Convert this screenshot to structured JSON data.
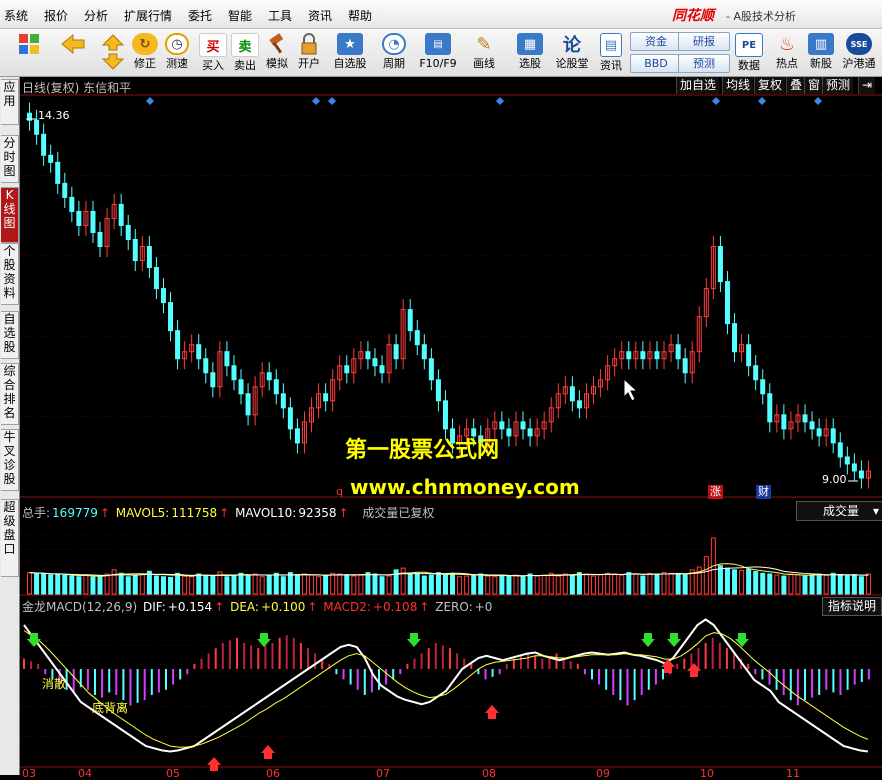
{
  "menu": [
    "系统",
    "报价",
    "分析",
    "扩展行情",
    "委托",
    "智能",
    "工具",
    "资讯",
    "帮助"
  ],
  "brand": {
    "logo": "同花顺",
    "subtitle": "- A股技术分析"
  },
  "toolbar": {
    "buttons": [
      {
        "label": "",
        "icon": "windows-icon"
      },
      {
        "label": "",
        "icon": "back-arrow-icon"
      },
      {
        "label": "",
        "icon": "up-down-icon"
      },
      {
        "label": "修正",
        "icon": "fix-icon"
      },
      {
        "label": "测速",
        "icon": "clock-icon"
      },
      {
        "label": "买入",
        "icon": "buy-icon",
        "glyph": "买"
      },
      {
        "label": "卖出",
        "icon": "sell-icon",
        "glyph": "卖"
      },
      {
        "label": "模拟",
        "icon": "gavel-icon"
      },
      {
        "label": "开户",
        "icon": "lock-icon"
      },
      {
        "label": "自选股",
        "icon": "star-icon"
      },
      {
        "label": "周期",
        "icon": "period-icon"
      },
      {
        "label": "F10/F9",
        "icon": "f10-icon"
      },
      {
        "label": "画线",
        "icon": "pencil-icon"
      },
      {
        "label": "选股",
        "icon": "select-icon"
      },
      {
        "label": "论股堂",
        "icon": "forum-icon",
        "glyph": "论"
      },
      {
        "label": "资讯",
        "icon": "news-icon"
      },
      {
        "label": "数据",
        "icon": "pe-icon",
        "glyph": "PE"
      },
      {
        "label": "热点",
        "icon": "fire-icon"
      },
      {
        "label": "新股",
        "icon": "newstock-icon"
      },
      {
        "label": "沪港通",
        "icon": "hk-icon"
      }
    ],
    "pills": [
      "资金",
      "研报",
      "BBD",
      "预测"
    ]
  },
  "sidebar": [
    "应用",
    "分时图",
    "K线图",
    "个股资料",
    "自选股",
    "综合排名",
    "牛叉诊股",
    "超级盘口"
  ],
  "main_header": {
    "title": "日线(复权) 东信和平"
  },
  "right_tabs": [
    "加自选",
    "均线",
    "复权",
    "叠",
    "窗",
    "预测"
  ],
  "price_high": "14.36",
  "price_low": "9.00",
  "volume_header": {
    "label": "总手:",
    "value": "169779",
    "ma5_label": "MAVOL5:",
    "ma5": "111758",
    "ma10_label": "MAVOL10:",
    "ma10": "92358",
    "note": "成交量已复权",
    "dropdown": "成交量"
  },
  "macd_header": {
    "label": "金龙MACD(12,26,9)",
    "dif_label": "DIF:",
    "dif": "+0.154",
    "dea_label": "DEA:",
    "dea": "+0.100",
    "macd2_label": "MACD2:",
    "macd2": "+0.108",
    "zero_label": "ZERO:",
    "zero": "+0",
    "help": "指标说明"
  },
  "macd_labels": {
    "a": "消散",
    "b": "底背离"
  },
  "badges": [
    {
      "text": "涨"
    },
    {
      "text": "财"
    },
    {
      "text": "q"
    }
  ],
  "watermark": {
    "cn": "第一股票公式网",
    "url": "www.chnmoney.com"
  },
  "months": [
    "03",
    "04",
    "05",
    "06",
    "07",
    "08",
    "09",
    "10",
    "11"
  ],
  "colors": {
    "up": "#ff3c3c",
    "down": "#54ffff",
    "dif": "#ffffff",
    "dea": "#ffff40",
    "accent": "#b01818"
  },
  "chart_data": {
    "type": "candlestick",
    "price_range": [
      9.0,
      14.36
    ],
    "closes": [
      14.2,
      14.0,
      13.7,
      13.6,
      13.3,
      13.1,
      12.9,
      12.7,
      12.9,
      12.6,
      12.4,
      12.8,
      13.0,
      12.7,
      12.5,
      12.2,
      12.4,
      12.1,
      11.8,
      11.6,
      11.2,
      10.8,
      10.9,
      11.0,
      10.8,
      10.6,
      10.4,
      10.9,
      10.7,
      10.5,
      10.3,
      10.0,
      10.4,
      10.6,
      10.5,
      10.3,
      10.1,
      9.8,
      9.6,
      9.9,
      10.1,
      10.3,
      10.2,
      10.5,
      10.7,
      10.6,
      10.8,
      10.9,
      10.8,
      10.7,
      10.6,
      11.0,
      10.8,
      11.5,
      11.2,
      11.0,
      10.8,
      10.5,
      10.2,
      9.8,
      9.6,
      9.7,
      9.8,
      9.7,
      9.6,
      9.8,
      9.9,
      9.8,
      9.7,
      9.9,
      9.8,
      9.7,
      9.8,
      9.9,
      10.1,
      10.3,
      10.4,
      10.2,
      10.1,
      10.3,
      10.4,
      10.5,
      10.7,
      10.8,
      10.9,
      10.8,
      10.9,
      10.8,
      10.9,
      10.8,
      10.9,
      11.0,
      10.8,
      10.6,
      10.9,
      11.4,
      11.8,
      12.4,
      11.9,
      11.3,
      10.9,
      11.0,
      10.7,
      10.5,
      10.3,
      9.9,
      10.0,
      9.8,
      9.9,
      10.0,
      9.9,
      9.8,
      9.7,
      9.8,
      9.6,
      9.4,
      9.3,
      9.2,
      9.1,
      9.2
    ]
  },
  "volume_data": [
    62,
    60,
    58,
    55,
    57,
    54,
    52,
    50,
    55,
    49,
    52,
    58,
    70,
    60,
    50,
    55,
    58,
    66,
    52,
    50,
    48,
    60,
    52,
    50,
    58,
    54,
    52,
    64,
    50,
    55,
    60,
    52,
    58,
    50,
    55,
    60,
    50,
    62,
    54,
    58,
    55,
    50,
    52,
    60,
    58,
    56,
    52,
    55,
    62,
    58,
    50,
    52,
    70,
    75,
    58,
    60,
    52,
    55,
    62,
    58,
    60,
    50,
    52,
    55,
    58,
    52,
    50,
    54,
    52,
    55,
    50,
    58,
    52,
    55,
    60,
    52,
    58,
    55,
    62,
    58,
    52,
    56,
    60,
    58,
    55,
    62,
    58,
    52,
    60,
    58,
    62,
    60,
    58,
    55,
    70,
    78,
    95,
    110,
    82,
    75,
    70,
    68,
    72,
    65,
    60,
    58,
    55,
    52,
    58,
    56,
    52,
    55,
    58,
    54,
    60,
    55,
    52,
    56,
    50,
    58
  ],
  "macd_hist": [
    4,
    3,
    2,
    -2,
    -4,
    -6,
    -8,
    -9,
    -7,
    -8,
    -10,
    -11,
    -9,
    -10,
    -12,
    -14,
    -13,
    -12,
    -10,
    -9,
    -8,
    -6,
    -4,
    -2,
    2,
    4,
    6,
    8,
    10,
    11,
    12,
    10,
    9,
    8,
    9,
    10,
    12,
    13,
    12,
    10,
    8,
    6,
    4,
    2,
    -2,
    -4,
    -6,
    -8,
    -10,
    -9,
    -8,
    -6,
    -4,
    -2,
    2,
    4,
    6,
    8,
    10,
    9,
    8,
    6,
    4,
    2,
    -2,
    -4,
    -3,
    -2,
    2,
    4,
    5,
    6,
    5,
    4,
    5,
    6,
    4,
    3,
    2,
    -2,
    -4,
    -6,
    -8,
    -10,
    -12,
    -14,
    -12,
    -10,
    -8,
    -6,
    -4,
    -2,
    2,
    4,
    6,
    8,
    10,
    12,
    10,
    8,
    6,
    4,
    2,
    -2,
    -4,
    -6,
    -8,
    -10,
    -12,
    -14,
    -12,
    -11,
    -10,
    -8,
    -9,
    -10,
    -8,
    -6,
    -5,
    -4
  ],
  "macd_dif": [
    0.4,
    0.3,
    0.2,
    0.1,
    0.0,
    -0.1,
    -0.2,
    -0.3,
    -0.35,
    -0.4,
    -0.45,
    -0.5,
    -0.55,
    -0.6,
    -0.65,
    -0.7,
    -0.72,
    -0.74,
    -0.75,
    -0.74,
    -0.72,
    -0.7,
    -0.65,
    -0.6,
    -0.55,
    -0.5,
    -0.45,
    -0.4,
    -0.35,
    -0.3,
    -0.25,
    -0.2,
    -0.15,
    -0.1,
    -0.05,
    0.0,
    0.05,
    0.1,
    0.15,
    0.2,
    0.22,
    0.2,
    0.1,
    -0.05,
    -0.15,
    -0.2,
    -0.25,
    -0.28,
    -0.3,
    -0.32,
    -0.3,
    -0.25,
    -0.2,
    -0.1,
    0.0,
    0.05,
    0.1,
    0.12,
    0.1,
    0.08,
    0.1,
    0.12,
    0.14,
    0.15,
    0.12,
    0.1,
    0.08,
    0.1,
    0.12,
    0.14,
    0.15,
    0.14,
    0.13,
    0.14,
    0.15,
    0.13,
    0.12,
    0.1,
    0.08,
    0.05,
    0.1,
    0.2,
    0.3,
    0.4,
    0.45,
    0.4,
    0.3,
    0.2,
    0.1,
    0.0,
    -0.1,
    -0.15,
    -0.2,
    -0.3,
    -0.35,
    -0.4,
    -0.45,
    -0.5,
    -0.55,
    -0.6,
    -0.65,
    -0.7,
    -0.72,
    -0.74,
    -0.75
  ],
  "macd_dea": [
    0.35,
    0.3,
    0.25,
    0.18,
    0.1,
    0.02,
    -0.06,
    -0.14,
    -0.22,
    -0.28,
    -0.34,
    -0.4,
    -0.45,
    -0.5,
    -0.55,
    -0.6,
    -0.64,
    -0.67,
    -0.7,
    -0.71,
    -0.71,
    -0.7,
    -0.68,
    -0.65,
    -0.62,
    -0.58,
    -0.54,
    -0.5,
    -0.45,
    -0.4,
    -0.36,
    -0.31,
    -0.27,
    -0.22,
    -0.17,
    -0.12,
    -0.07,
    -0.02,
    0.03,
    0.08,
    0.12,
    0.14,
    0.12,
    0.06,
    0.0,
    -0.06,
    -0.12,
    -0.17,
    -0.21,
    -0.24,
    -0.26,
    -0.25,
    -0.23,
    -0.18,
    -0.12,
    -0.06,
    0.0,
    0.04,
    0.06,
    0.07,
    0.08,
    0.09,
    0.1,
    0.12,
    0.12,
    0.11,
    0.1,
    0.1,
    0.11,
    0.12,
    0.13,
    0.13,
    0.13,
    0.13,
    0.14,
    0.13,
    0.13,
    0.12,
    0.11,
    0.09,
    0.09,
    0.12,
    0.17,
    0.23,
    0.3,
    0.33,
    0.32,
    0.28,
    0.22,
    0.15,
    0.08,
    0.02,
    -0.04,
    -0.11,
    -0.17,
    -0.23,
    -0.28,
    -0.33,
    -0.38,
    -0.43,
    -0.48,
    -0.53,
    -0.57,
    -0.61,
    -0.64
  ]
}
